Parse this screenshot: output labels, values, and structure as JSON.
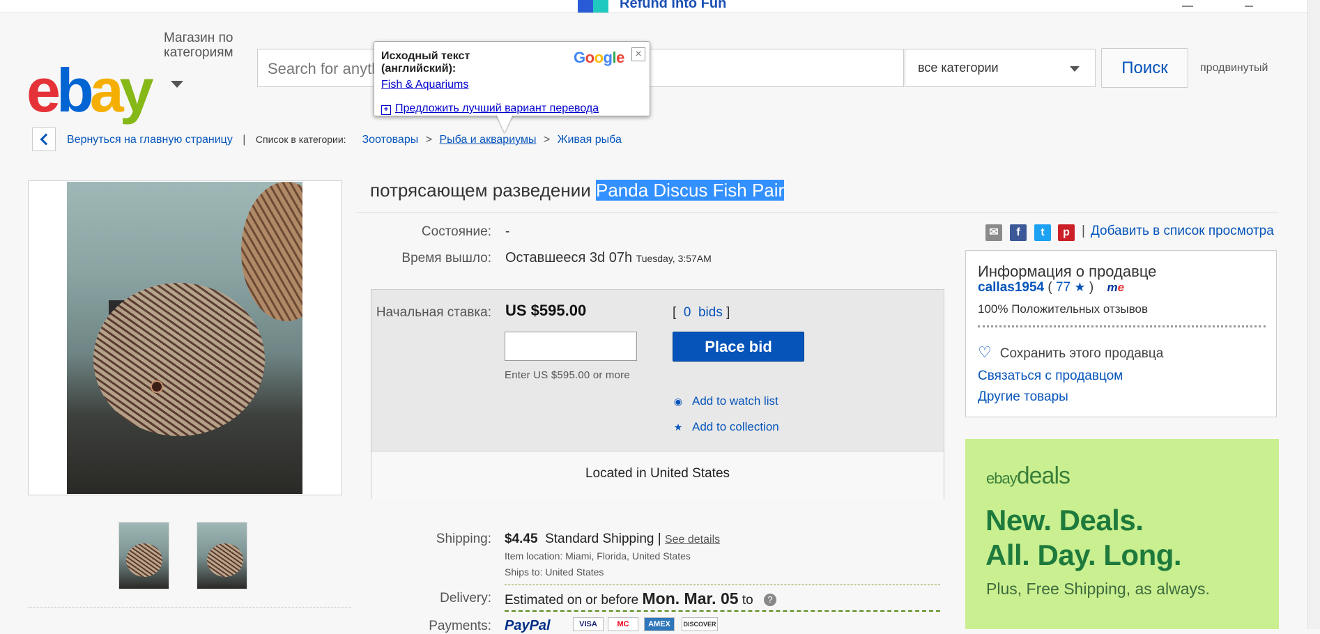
{
  "promo": {
    "text": "Refund Into Fun"
  },
  "header": {
    "shop_by_category": "Магазин по категориям",
    "search_placeholder": "Search for anything",
    "category_selected": "все категории",
    "search_button": "Поиск",
    "advanced": "продвинутый"
  },
  "translate_popup": {
    "source_label": "Исходный текст (английский):",
    "source_link": "Fish & Aquariums",
    "suggest": "Предложить лучший вариант перевода",
    "brand": "Google"
  },
  "breadcrumb": {
    "back": "Вернуться на главную страницу",
    "listed_in": "Список в категории:",
    "items": [
      "Зоотовары",
      "Рыба и аквариумы",
      "Живая рыба"
    ]
  },
  "listing": {
    "title_prefix": "потрясающем разведении",
    "title_highlight": "Panda Discus Fish Pair",
    "condition_label": "Состояние:",
    "condition_value": "-",
    "time_label": "Время вышло:",
    "time_left": "Оставшееся 3d 07h",
    "time_end": "Tuesday, 3:57AM"
  },
  "share": {
    "watch_label": "Добавить в список просмотра"
  },
  "bid": {
    "start_label": "Начальная ставка:",
    "price": "US $595.00",
    "bids_count": "0",
    "bids_word": "bids",
    "button": "Place bid",
    "hint": "Enter US $595.00 or more",
    "watch": "Add to watch list",
    "collection": "Add to collection",
    "located": "Located in United States"
  },
  "seller": {
    "heading": "Информация о продавце",
    "name": "callas1954",
    "score": "77",
    "positive": "100% Положительных отзывов",
    "save": "Сохранить этого продавца",
    "contact": "Связаться с продавцом",
    "other": "Другие товары"
  },
  "deals": {
    "brand_small": "ebay",
    "brand": "deals",
    "line1": "New. Deals.",
    "line2": "All. Day. Long.",
    "sub": "Plus, Free Shipping, as always."
  },
  "shipping": {
    "label": "Shipping:",
    "price": "$4.45",
    "service": "Standard Shipping",
    "details": "See details",
    "location": "Item location:  Miami, Florida, United States",
    "ships_to": "Ships to:  United States",
    "delivery_label": "Delivery:",
    "delivery_prefix": "Estimated on or before",
    "delivery_date": "Mon. Mar. 05",
    "delivery_suffix": "to",
    "payments_label": "Payments:",
    "paypal": "PayPal",
    "cards": [
      "VISA",
      "MC",
      "AMEX",
      "DISCOVER"
    ]
  },
  "colors": {
    "link": "#0654ba",
    "highlight": "#3390ff",
    "deals_bg": "#c9ef90"
  }
}
